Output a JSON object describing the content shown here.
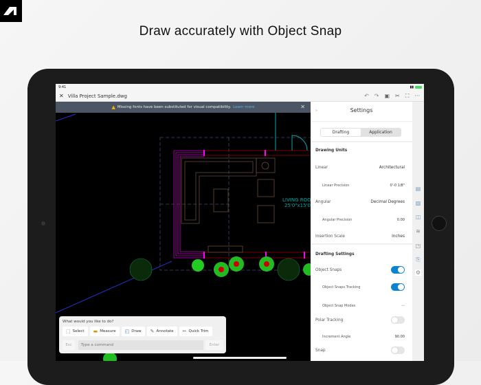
{
  "headline": "Draw accurately with Object Snap",
  "status": {
    "time": "9:41"
  },
  "toolbar": {
    "file_name": "Villa Project Sample.dwg"
  },
  "banner": {
    "message": "Missing fonts have been substituted for visual compatibility.",
    "link": "Learn more"
  },
  "canvas": {
    "room_label": "LIVING ROO",
    "room_size": "25'0\"x15'0"
  },
  "settings": {
    "title": "Settings",
    "tabs": [
      {
        "label": "Drafting",
        "selected": true
      },
      {
        "label": "Application",
        "selected": false
      }
    ],
    "drawing_units": "Drawing Units",
    "linear": {
      "label": "Linear",
      "value": "Architectural"
    },
    "linear_precision": {
      "label": "Linear Precision",
      "value": "0'-0 1/8\""
    },
    "angular": {
      "label": "Angular",
      "value": "Decimal Degrees"
    },
    "angular_precision": {
      "label": "Angular Precision",
      "value": "0.00"
    },
    "insertion_scale": {
      "label": "Insertion Scale",
      "value": "Inches"
    },
    "drafting_settings": "Drafting Settings",
    "object_snaps": {
      "label": "Object Snaps",
      "on": true
    },
    "object_snaps_tracking": {
      "label": "Object Snaps Tracking",
      "on": true
    },
    "object_snap_modes": {
      "label": "Object Snap Modes",
      "value": "···"
    },
    "polar_tracking": {
      "label": "Polar Tracking",
      "on": false
    },
    "increment_angle": {
      "label": "Increment Angle",
      "value": "90.00"
    },
    "snap": {
      "label": "Snap",
      "on": false
    }
  },
  "command": {
    "prompt": "What would you like to do?",
    "chips": [
      {
        "label": "Select"
      },
      {
        "label": "Measure"
      },
      {
        "label": "Draw"
      },
      {
        "label": "Annotate"
      },
      {
        "label": "Quick Trim"
      }
    ],
    "esc": "Esc",
    "placeholder": "Type a command",
    "enter": "Enter"
  },
  "colors": {
    "accent": "#0a84d0",
    "wall": "#ff00ff",
    "banner": "#4b5563"
  }
}
